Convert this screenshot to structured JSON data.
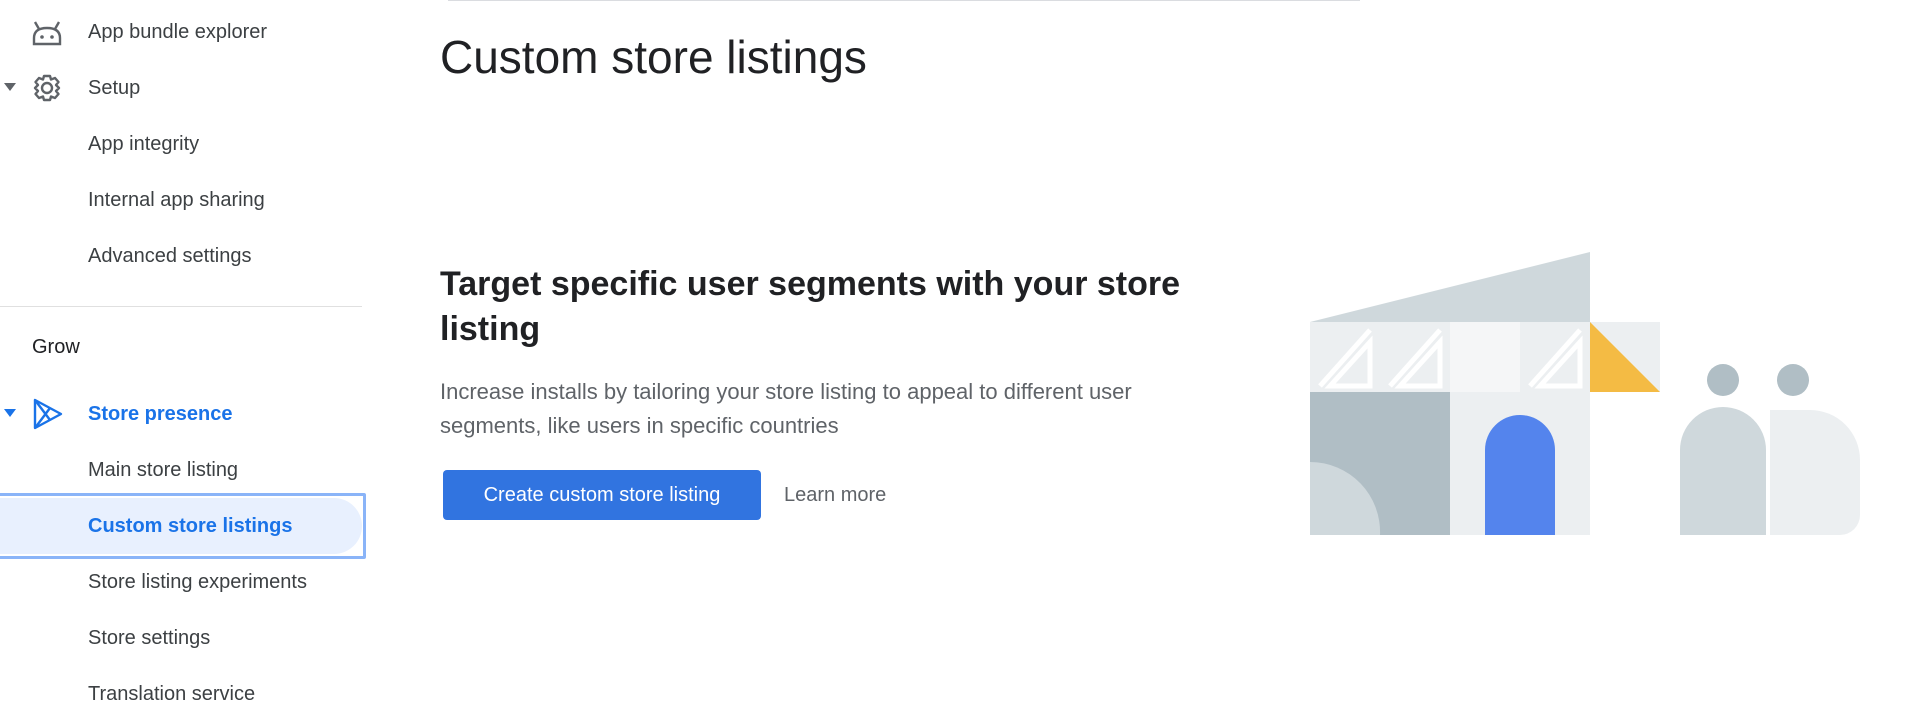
{
  "sidebar": {
    "items": [
      {
        "label": "App bundle explorer",
        "icon": "android-icon"
      },
      {
        "label": "Setup",
        "icon": "gear-icon",
        "expanded": true
      },
      {
        "label": "App integrity"
      },
      {
        "label": "Internal app sharing"
      },
      {
        "label": "Advanced settings"
      }
    ],
    "section_heading": "Grow",
    "store_presence": {
      "label": "Store presence",
      "icon": "play-icon",
      "expanded": true
    },
    "store_items": [
      {
        "label": "Main store listing"
      },
      {
        "label": "Custom store listings",
        "selected": true
      },
      {
        "label": "Store listing experiments"
      },
      {
        "label": "Store settings"
      },
      {
        "label": "Translation service"
      }
    ]
  },
  "main": {
    "title": "Custom store listings",
    "empty_state": {
      "heading": "Target specific user segments with your store listing",
      "description": "Increase installs by tailoring your store listing to appeal to different user segments, like users in specific countries",
      "primary_button": "Create custom store listing",
      "secondary_button": "Learn more"
    }
  },
  "colors": {
    "accent": "#1a73e8",
    "button": "#3174e0",
    "selected_bg": "#e8f0fe",
    "focus_ring": "#8ab4f8",
    "illustration_yellow": "#f4bb44",
    "illustration_blue": "#5484ed"
  }
}
